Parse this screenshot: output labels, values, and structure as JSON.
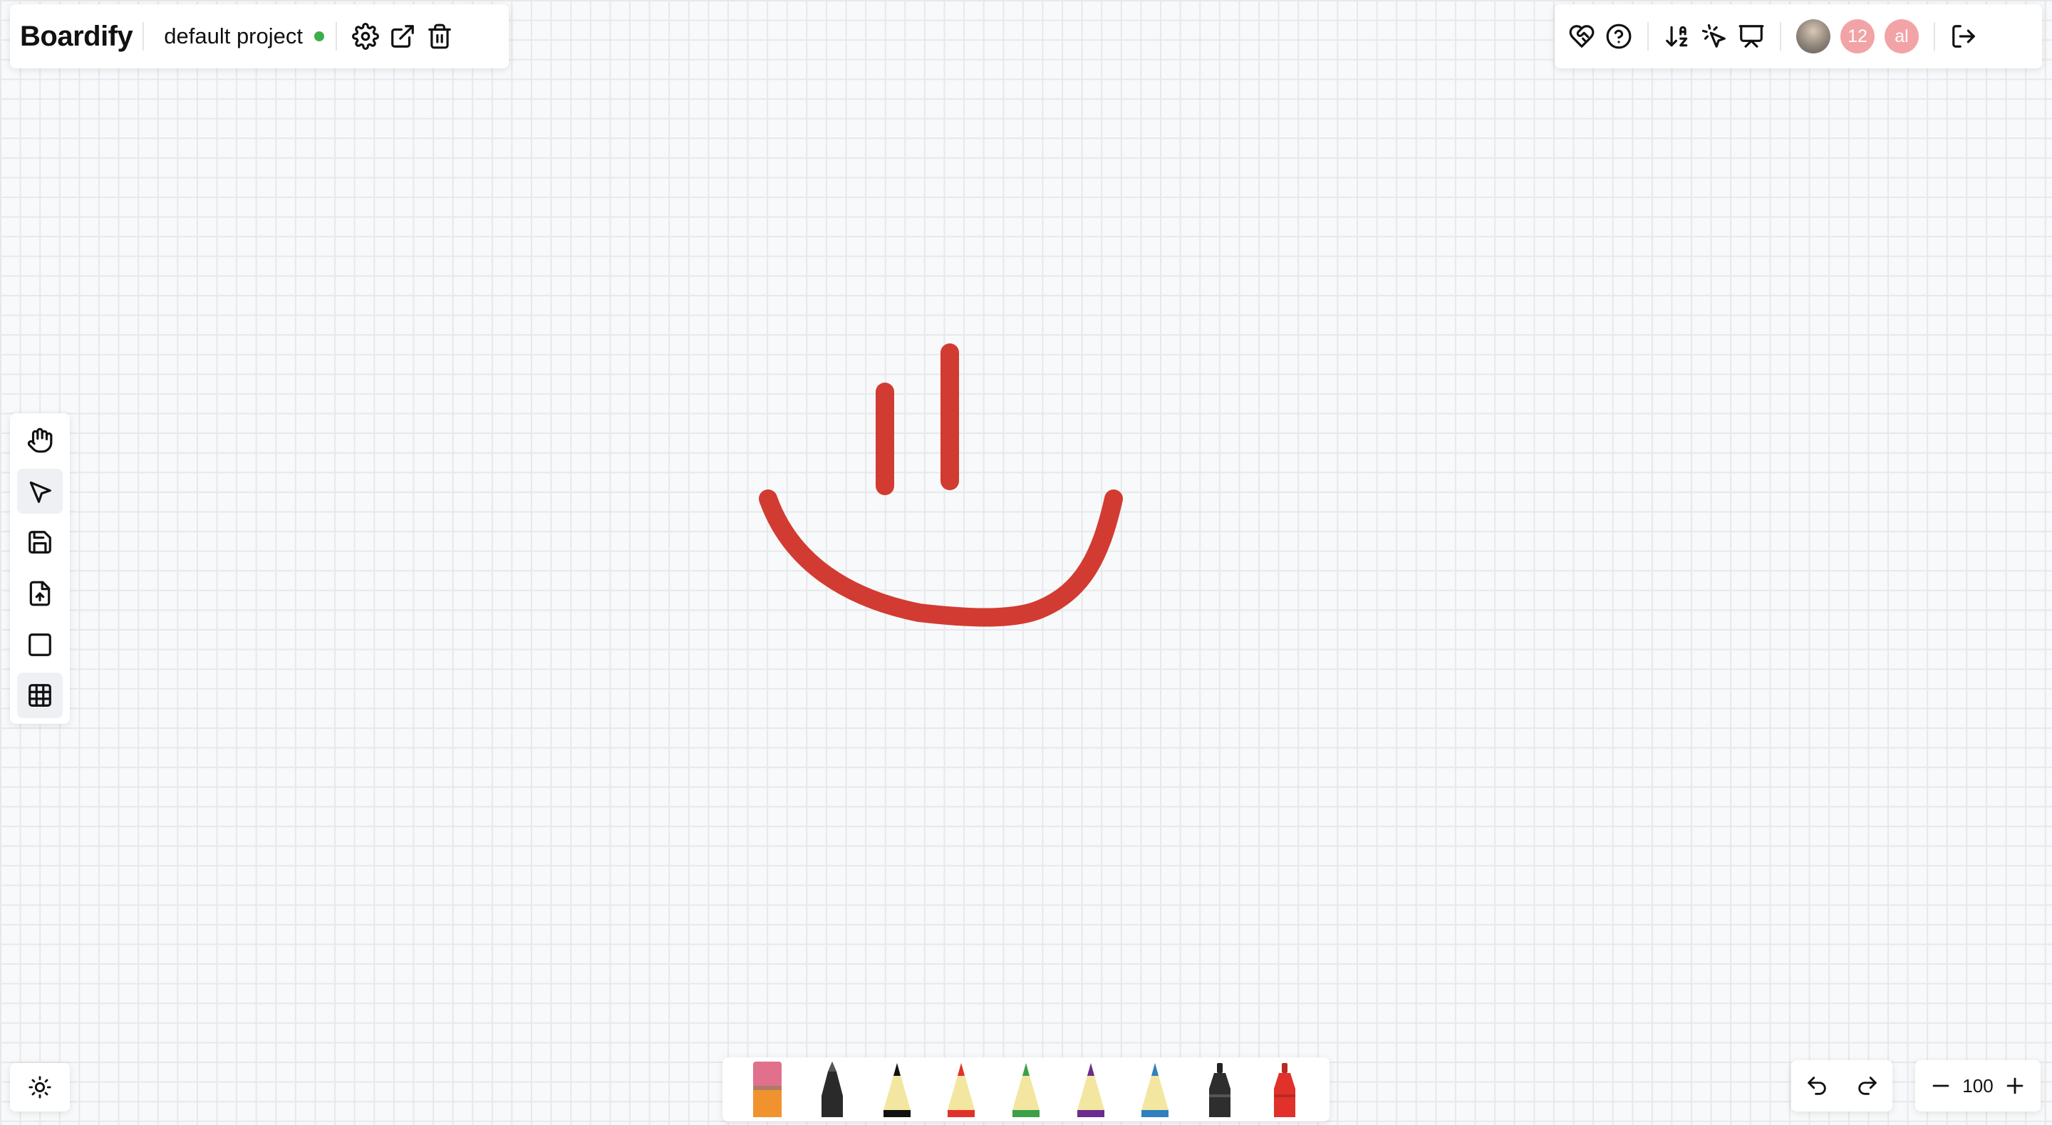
{
  "app": {
    "title": "Boardify"
  },
  "project": {
    "name": "default project",
    "status_color": "#3fae4a"
  },
  "header_left_icons": [
    "gear-icon",
    "external-link-icon",
    "trash-icon"
  ],
  "header_right_icons": [
    "heart-handshake-icon",
    "help-circle-icon",
    "sort-az-icon",
    "pointer-click-icon",
    "presentation-icon",
    "logout-icon"
  ],
  "collaborators": [
    {
      "type": "photo",
      "label": ""
    },
    {
      "type": "initials",
      "label": "12",
      "color": "#f2a3a6"
    },
    {
      "type": "initials",
      "label": "al",
      "color": "#f2a3a6"
    }
  ],
  "left_tools": [
    "hand-icon",
    "cursor-icon",
    "save-icon",
    "upload-file-icon",
    "square-icon",
    "grid-table-icon"
  ],
  "active_tool": "grid-table-icon",
  "drawing": {
    "stroke_color": "#d23b31"
  },
  "pens": [
    {
      "name": "eraser",
      "color": "#e0708c"
    },
    {
      "name": "black-marker",
      "color": "#222222"
    },
    {
      "name": "black-pencil",
      "color": "#111111"
    },
    {
      "name": "red-pencil",
      "color": "#e0322a"
    },
    {
      "name": "green-pencil",
      "color": "#3aa14a"
    },
    {
      "name": "purple-pencil",
      "color": "#6b2c8f"
    },
    {
      "name": "blue-pencil",
      "color": "#2f7fc1"
    },
    {
      "name": "dark-marker",
      "color": "#2e2e2e"
    },
    {
      "name": "red-marker",
      "color": "#e0322a"
    }
  ],
  "zoom": {
    "value": "100"
  },
  "theme_icon": "sun-icon"
}
